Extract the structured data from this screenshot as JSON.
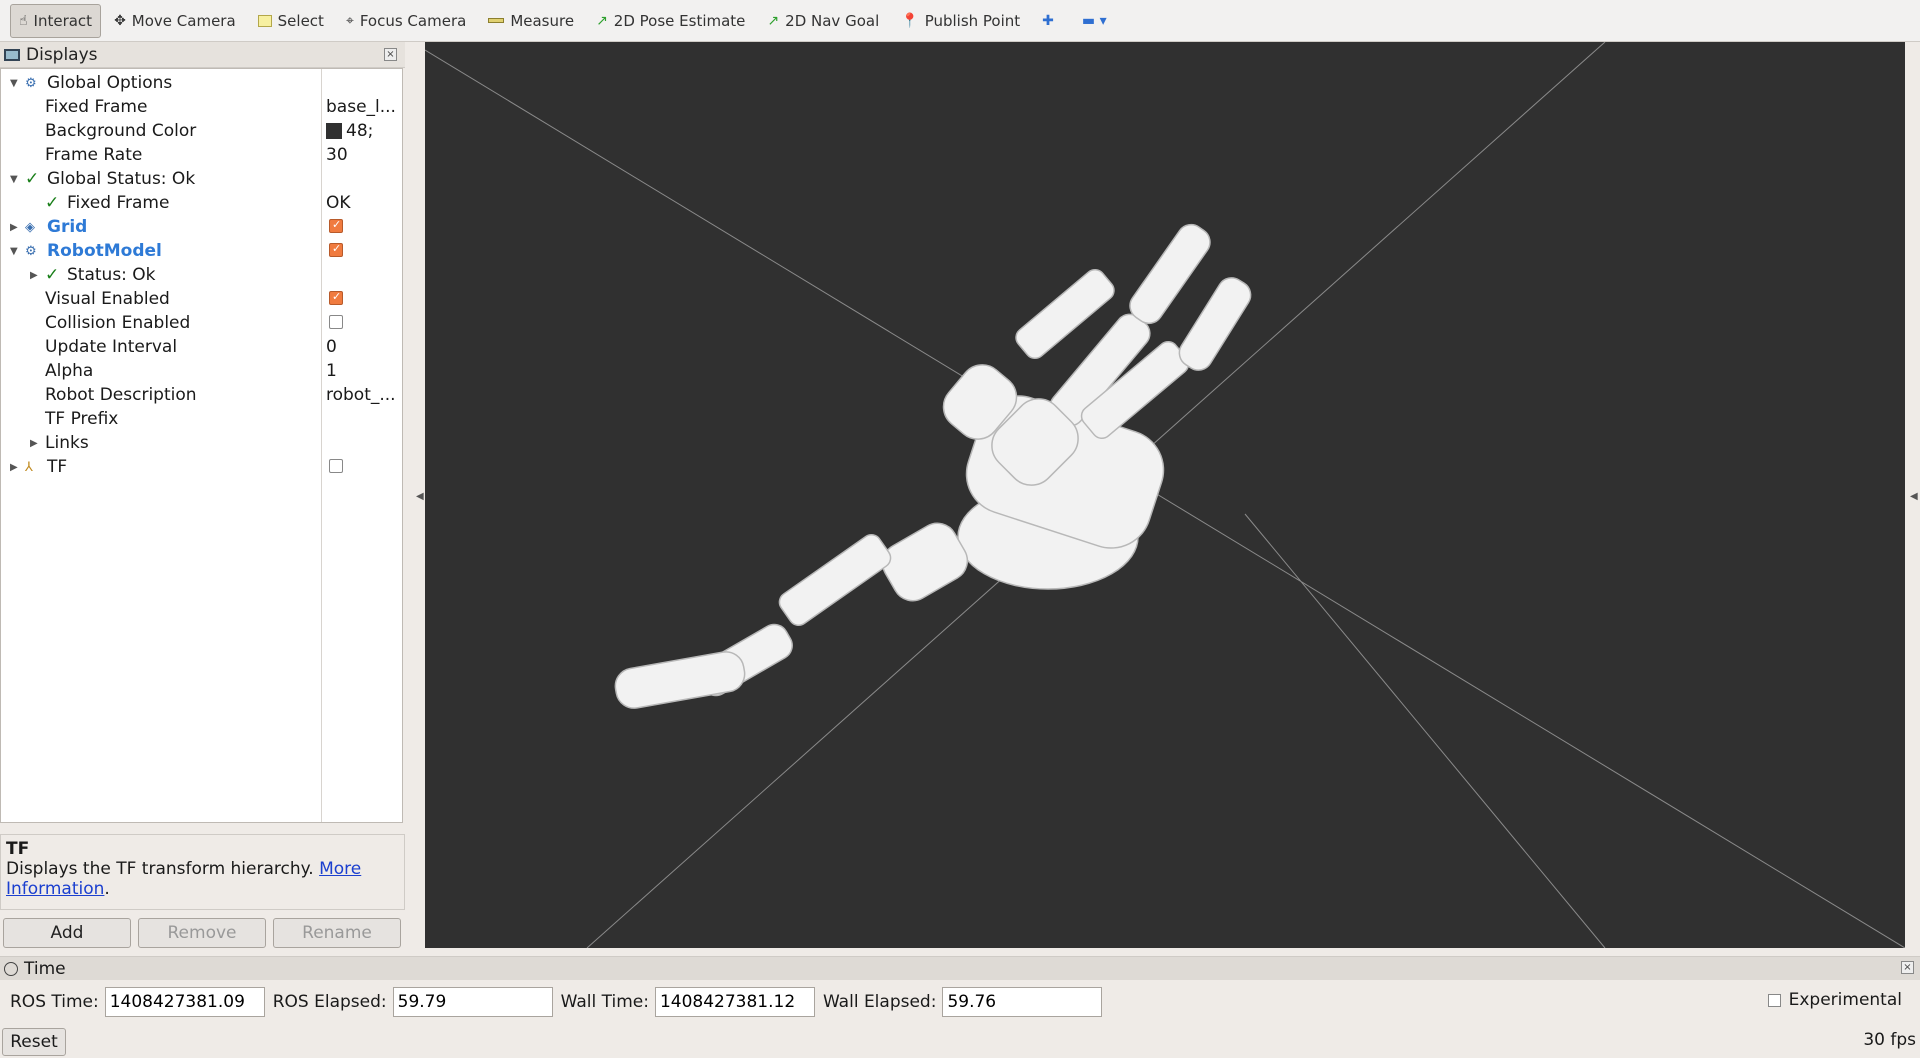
{
  "toolbar": {
    "tools": [
      {
        "label": "Interact",
        "icon": "hand-cursor-icon",
        "active": true
      },
      {
        "label": "Move Camera",
        "icon": "move-camera-icon"
      },
      {
        "label": "Select",
        "icon": "select-box-icon"
      },
      {
        "label": "Focus Camera",
        "icon": "focus-crosshair-icon"
      },
      {
        "label": "Measure",
        "icon": "ruler-icon"
      },
      {
        "label": "2D Pose Estimate",
        "icon": "green-arrow-icon"
      },
      {
        "label": "2D Nav Goal",
        "icon": "green-arrow-icon"
      },
      {
        "label": "Publish Point",
        "icon": "map-pin-icon"
      }
    ],
    "add_tool_icon": "plus-icon",
    "remove_tool_icon": "minus-dropdown-icon"
  },
  "displays": {
    "title": "Displays",
    "rows": {
      "global_options": {
        "label": "Global Options"
      },
      "fixed_frame": {
        "label": "Fixed Frame",
        "value": "base_l..."
      },
      "background_color": {
        "label": "Background Color",
        "value": "48;",
        "swatch": "#303030"
      },
      "frame_rate": {
        "label": "Frame Rate",
        "value": "30"
      },
      "global_status": {
        "label": "Global Status: Ok"
      },
      "status_fixed_frame": {
        "label": "Fixed Frame",
        "value": "OK"
      },
      "grid": {
        "label": "Grid",
        "enabled": true
      },
      "robot_model": {
        "label": "RobotModel",
        "enabled": true
      },
      "rm_status": {
        "label": "Status: Ok"
      },
      "visual_enabled": {
        "label": "Visual Enabled",
        "enabled": true
      },
      "collision_enabled": {
        "label": "Collision Enabled",
        "enabled": false
      },
      "update_interval": {
        "label": "Update Interval",
        "value": "0"
      },
      "alpha": {
        "label": "Alpha",
        "value": "1"
      },
      "robot_description": {
        "label": "Robot Description",
        "value": "robot_..."
      },
      "tf_prefix": {
        "label": "TF Prefix"
      },
      "links": {
        "label": "Links"
      },
      "tf": {
        "label": "TF",
        "enabled": false
      }
    }
  },
  "description": {
    "title": "TF",
    "text": "Displays the TF transform hierarchy. ",
    "link_line1": "More",
    "link_line2": "Information",
    "period": "."
  },
  "buttons": {
    "add": "Add",
    "remove": "Remove",
    "rename": "Rename"
  },
  "time": {
    "title": "Time",
    "ros_time_label": "ROS Time:",
    "ros_time": "1408427381.09",
    "ros_elapsed_label": "ROS Elapsed:",
    "ros_elapsed": "59.79",
    "wall_time_label": "Wall Time:",
    "wall_time": "1408427381.12",
    "wall_elapsed_label": "Wall Elapsed:",
    "wall_elapsed": "59.76",
    "experimental_label": "Experimental"
  },
  "status": {
    "reset_label": "Reset",
    "fps": "30 fps"
  },
  "colors": {
    "viewport_bg": "#303030",
    "accent_checkbox": "#f07b3f",
    "link_blue": "#2e7ad6"
  }
}
